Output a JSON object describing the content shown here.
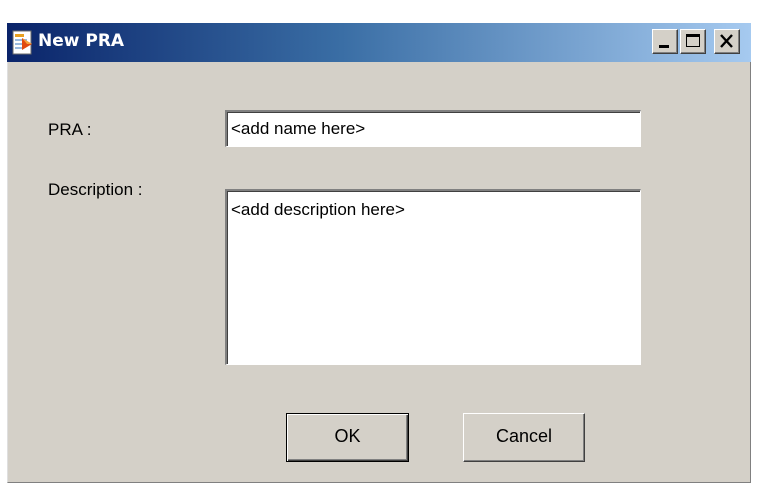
{
  "window": {
    "title": "New PRA",
    "icon": "app-document-icon",
    "controls": {
      "minimize_icon": "minimize-icon",
      "maximize_icon": "maximize-icon",
      "close_icon": "close-icon"
    },
    "titlebar_colors": [
      "#0a246a",
      "#a6caf0"
    ],
    "background_color": "#d4d0c8"
  },
  "form": {
    "pra_label": "PRA :",
    "pra_value": "<add name here>",
    "description_label": "Description :",
    "description_value": "<add description here>"
  },
  "buttons": {
    "ok_label": "OK",
    "cancel_label": "Cancel"
  }
}
